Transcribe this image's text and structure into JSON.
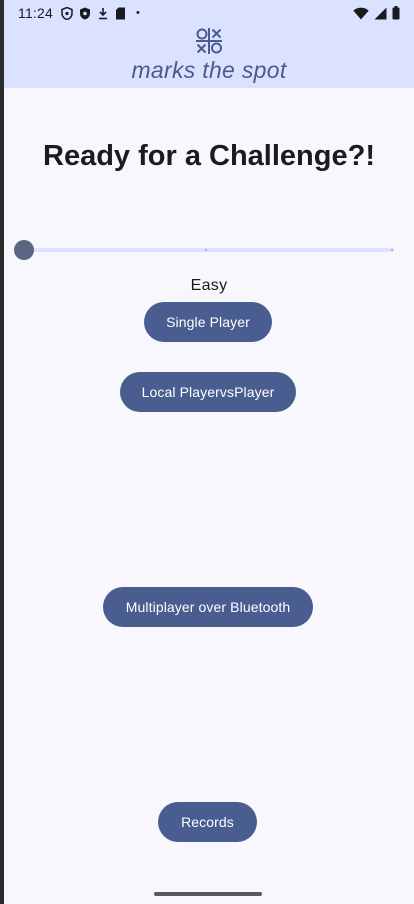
{
  "status_bar": {
    "time": "11:24",
    "left_icons": [
      "shield-icon",
      "shield-filled-icon",
      "download-icon",
      "sd-card-icon"
    ],
    "dot": "•",
    "right_icons": [
      "wifi-icon",
      "signal-icon",
      "battery-icon"
    ]
  },
  "header": {
    "logo_icon": "tic-tac-toe-logo-icon",
    "subtitle": "marks the spot"
  },
  "main": {
    "title": "Ready for a Challenge?!",
    "difficulty_slider": {
      "value": 0,
      "steps": 3
    },
    "difficulty_label": "Easy",
    "single_player_label": "Single Player",
    "local_pvp_label": "Local PlayervsPlayer",
    "bluetooth_label": "Multiplayer over Bluetooth",
    "records_label": "Records"
  },
  "colors": {
    "header_bg": "#dae2ff",
    "page_bg": "#f8f7fd",
    "button_bg": "#4a5d90",
    "subtitle": "#4a5a8c",
    "slider_thumb": "#5a6683"
  }
}
